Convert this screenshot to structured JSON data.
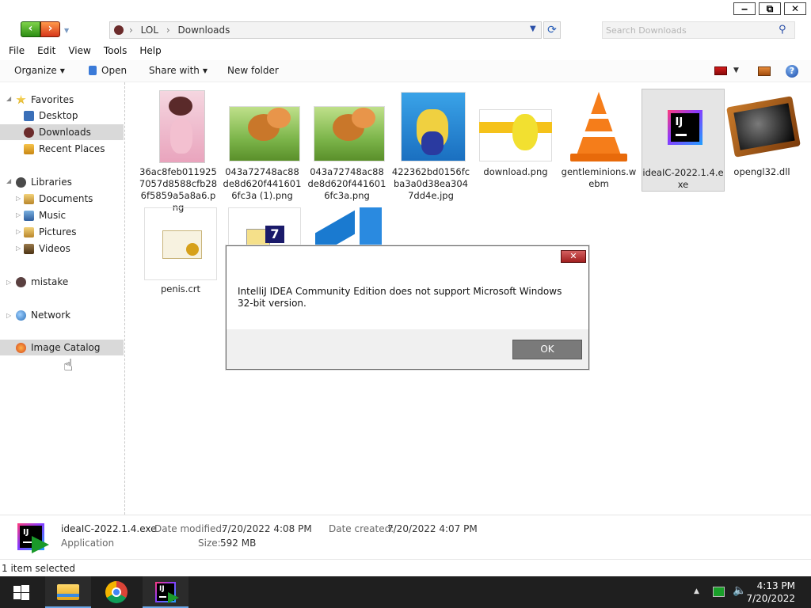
{
  "window": {
    "controls": {
      "minimize": "‒",
      "maximize": "⧉",
      "close": "✕"
    }
  },
  "address": {
    "crumbs": [
      "LOL",
      "Downloads"
    ],
    "search_placeholder": "Search Downloads"
  },
  "menu": [
    "File",
    "Edit",
    "View",
    "Tools",
    "Help"
  ],
  "toolbar": {
    "organize": "Organize",
    "open": "Open",
    "share_with": "Share with",
    "new_folder": "New folder"
  },
  "sidebar": {
    "favorites": "Favorites",
    "desktop": "Desktop",
    "downloads": "Downloads",
    "recent_places": "Recent Places",
    "libraries": "Libraries",
    "documents": "Documents",
    "music": "Music",
    "pictures": "Pictures",
    "videos": "Videos",
    "mistake": "mistake",
    "network": "Network",
    "image_catalog": "Image Catalog"
  },
  "files": [
    {
      "name": "36ac8feb0119257057d8588cfb286f5859a5a8a6.png"
    },
    {
      "name": "043a72748ac88de8d620f4416016fc3a (1).png"
    },
    {
      "name": "043a72748ac88de8d620f4416016fc3a.png"
    },
    {
      "name": "422362bd0156fcba3a0d38ea3047dd4e.jpg"
    },
    {
      "name": "download.png"
    },
    {
      "name": "gentleminions.webm"
    },
    {
      "name": "ideaIC-2022.1.4.exe"
    },
    {
      "name": "opengl32.dll"
    },
    {
      "name": "penis.crt"
    }
  ],
  "dialog": {
    "message": "IntelliJ IDEA Community Edition does not support Microsoft Windows 32-bit version.",
    "ok": "OK",
    "close": "✕"
  },
  "details": {
    "filename": "ideaIC-2022.1.4.exe",
    "type": "Application",
    "date_modified_label": "Date modified:",
    "date_modified": "7/20/2022 4:08 PM",
    "date_created_label": "Date created:",
    "date_created": "7/20/2022 4:07 PM",
    "size_label": "Size:",
    "size": "592 MB"
  },
  "status": {
    "selection": "1 item selected"
  },
  "taskbar": {
    "time": "4:13 PM",
    "date": "7/20/2022"
  },
  "colors": {
    "accent": "#6aa7e8",
    "taskbar": "#1f1f1f",
    "selection": "#d9d9d9"
  }
}
